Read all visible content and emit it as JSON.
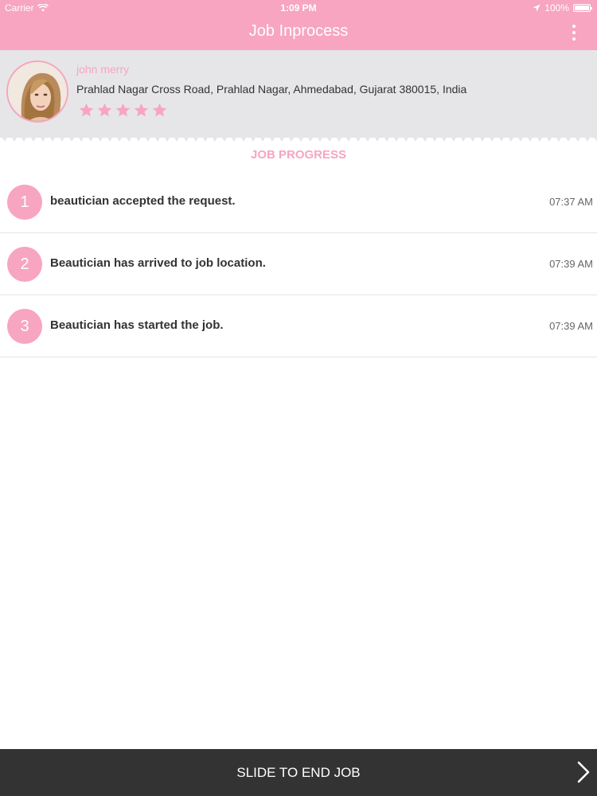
{
  "status_bar": {
    "carrier": "Carrier",
    "time": "1:09 PM",
    "battery": "100%"
  },
  "nav": {
    "title": "Job Inprocess",
    "menu_icon": "more-vertical-icon"
  },
  "profile": {
    "name": "john merry",
    "address": "Prahlad Nagar Cross Road,  Prahlad Nagar,  Ahmedabad,  Gujarat 380015,  India",
    "rating": 5,
    "rating_max": 5
  },
  "progress": {
    "title": "JOB PROGRESS",
    "steps": [
      {
        "number": "1",
        "text": "beautician accepted the request.",
        "time": "07:37 AM"
      },
      {
        "number": "2",
        "text": "Beautician has arrived to job location.",
        "time": "07:39 AM"
      },
      {
        "number": "3",
        "text": "Beautician has started the job.",
        "time": "07:39 AM"
      }
    ]
  },
  "footer": {
    "slide_label": "SLIDE TO END JOB",
    "icon": "chevron-right-icon"
  },
  "colors": {
    "accent": "#f7a5c0",
    "footer": "#333333",
    "profile_bg": "#e6e6e8"
  }
}
